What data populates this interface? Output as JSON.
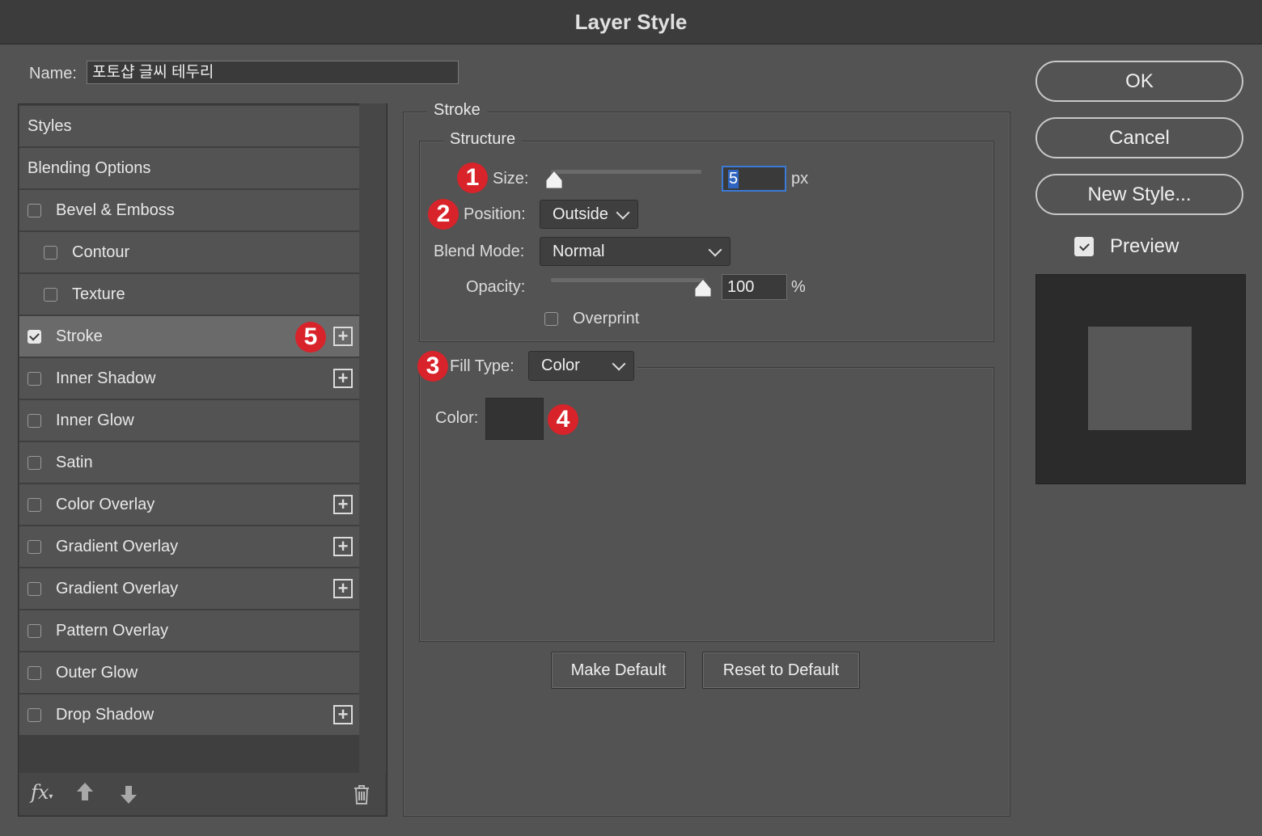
{
  "window": {
    "title": "Layer Style"
  },
  "name_field": {
    "label": "Name:",
    "value": "포토샵 글씨 테두리"
  },
  "styles_list": {
    "items": [
      {
        "label": "Styles",
        "checkbox": false,
        "checked": false,
        "plus": false,
        "selected": false
      },
      {
        "label": "Blending Options",
        "checkbox": false,
        "checked": false,
        "plus": false,
        "selected": false
      },
      {
        "label": "Bevel & Emboss",
        "checkbox": true,
        "checked": false,
        "plus": false,
        "selected": false
      },
      {
        "label": "Contour",
        "checkbox": true,
        "checked": false,
        "plus": false,
        "selected": false,
        "indent": true
      },
      {
        "label": "Texture",
        "checkbox": true,
        "checked": false,
        "plus": false,
        "selected": false,
        "indent": true
      },
      {
        "label": "Stroke",
        "checkbox": true,
        "checked": true,
        "plus": true,
        "selected": true
      },
      {
        "label": "Inner Shadow",
        "checkbox": true,
        "checked": false,
        "plus": true,
        "selected": false
      },
      {
        "label": "Inner Glow",
        "checkbox": true,
        "checked": false,
        "plus": false,
        "selected": false
      },
      {
        "label": "Satin",
        "checkbox": true,
        "checked": false,
        "plus": false,
        "selected": false
      },
      {
        "label": "Color Overlay",
        "checkbox": true,
        "checked": false,
        "plus": true,
        "selected": false
      },
      {
        "label": "Gradient Overlay",
        "checkbox": true,
        "checked": false,
        "plus": true,
        "selected": false
      },
      {
        "label": "Gradient Overlay",
        "checkbox": true,
        "checked": false,
        "plus": true,
        "selected": false
      },
      {
        "label": "Pattern Overlay",
        "checkbox": true,
        "checked": false,
        "plus": false,
        "selected": false
      },
      {
        "label": "Outer Glow",
        "checkbox": true,
        "checked": false,
        "plus": false,
        "selected": false
      },
      {
        "label": "Drop Shadow",
        "checkbox": true,
        "checked": false,
        "plus": true,
        "selected": false
      }
    ],
    "footer": {
      "fx_label": "fx",
      "up_icon": "arrow-up-icon",
      "down_icon": "arrow-down-icon",
      "trash_icon": "trash-icon"
    }
  },
  "stroke_panel": {
    "title": "Stroke",
    "structure": {
      "title": "Structure",
      "size": {
        "label": "Size:",
        "value": "5",
        "unit": "px",
        "slider_level": 0.0
      },
      "position": {
        "label": "Position:",
        "value": "Outside"
      },
      "blend_mode": {
        "label": "Blend Mode:",
        "value": "Normal"
      },
      "opacity": {
        "label": "Opacity:",
        "value": "100",
        "unit": "%",
        "slider_level": 1.0
      },
      "overprint": {
        "label": "Overprint",
        "checked": false
      }
    },
    "fill_type": {
      "label": "Fill Type:",
      "value": "Color"
    },
    "color": {
      "label": "Color:",
      "swatch": "#333333"
    },
    "make_default": "Make Default",
    "reset_default": "Reset to Default"
  },
  "annotations": [
    "1",
    "2",
    "3",
    "4",
    "5"
  ],
  "actions": {
    "ok": "OK",
    "cancel": "Cancel",
    "new_style": "New Style...",
    "preview": {
      "label": "Preview",
      "checked": true
    }
  },
  "colors": {
    "background": "#535353",
    "annotation_red": "#d8232a",
    "focus_blue": "#3b7ad6"
  }
}
